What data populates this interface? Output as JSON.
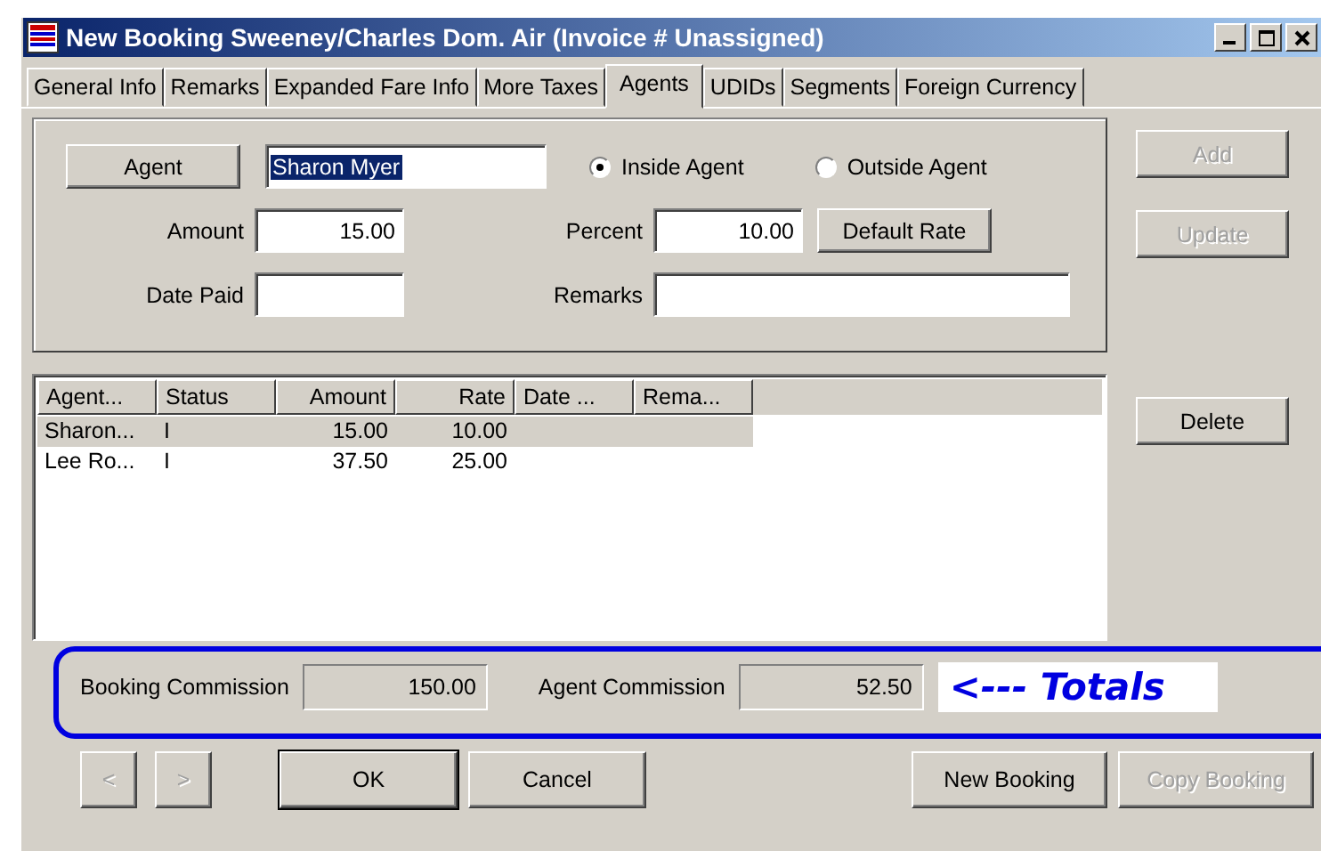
{
  "window": {
    "title": "New Booking Sweeney/Charles Dom. Air (Invoice # Unassigned)"
  },
  "tabs": [
    {
      "label": "General Info",
      "selected": false
    },
    {
      "label": "Remarks",
      "selected": false
    },
    {
      "label": "Expanded Fare Info",
      "selected": false
    },
    {
      "label": "More Taxes",
      "selected": false
    },
    {
      "label": "Agents",
      "selected": true
    },
    {
      "label": "UDIDs",
      "selected": false
    },
    {
      "label": "Segments",
      "selected": false
    },
    {
      "label": "Foreign Currency",
      "selected": false
    }
  ],
  "form": {
    "agent_button": "Agent",
    "agent_value": "Sharon Myer",
    "agent_type": [
      {
        "label": "Inside Agent",
        "selected": true
      },
      {
        "label": "Outside Agent",
        "selected": false
      }
    ],
    "amount": {
      "label": "Amount",
      "value": "15.00"
    },
    "percent": {
      "label": "Percent",
      "value": "10.00"
    },
    "default_rate_button": "Default Rate",
    "date_paid": {
      "label": "Date Paid"
    },
    "remarks": {
      "label": "Remarks"
    }
  },
  "side_buttons": [
    {
      "label": "Add",
      "disabled": true
    },
    {
      "label": "Update",
      "disabled": true
    },
    {
      "label": "Delete",
      "disabled": false
    }
  ],
  "table": {
    "columns": [
      {
        "label": "Agent..."
      },
      {
        "label": "Status"
      },
      {
        "label": "Amount"
      },
      {
        "label": "Rate"
      },
      {
        "label": "Date ..."
      },
      {
        "label": "Rema..."
      }
    ],
    "rows": [
      {
        "selected": true,
        "cells": [
          "Sharon...",
          "I",
          "15.00",
          "10.00"
        ]
      },
      {
        "selected": false,
        "cells": [
          "Lee Ro...",
          "I",
          "37.50",
          "25.00"
        ]
      }
    ]
  },
  "totals": {
    "booking_commission": {
      "label": "Booking Commission",
      "value": "150.00"
    },
    "agent_commission": {
      "label": "Agent Commission",
      "value": "52.50"
    },
    "annotation": "<--- Totals"
  },
  "nav_buttons": [
    {
      "label": "<",
      "disabled": true
    },
    {
      "label": ">",
      "disabled": true
    }
  ],
  "buttons": [
    {
      "label": "OK",
      "disabled": false,
      "default": true
    },
    {
      "label": "Cancel",
      "disabled": false,
      "default": false
    }
  ],
  "right_buttons": [
    {
      "label": "New Booking",
      "disabled": false
    },
    {
      "label": "Copy Booking",
      "disabled": true
    }
  ]
}
